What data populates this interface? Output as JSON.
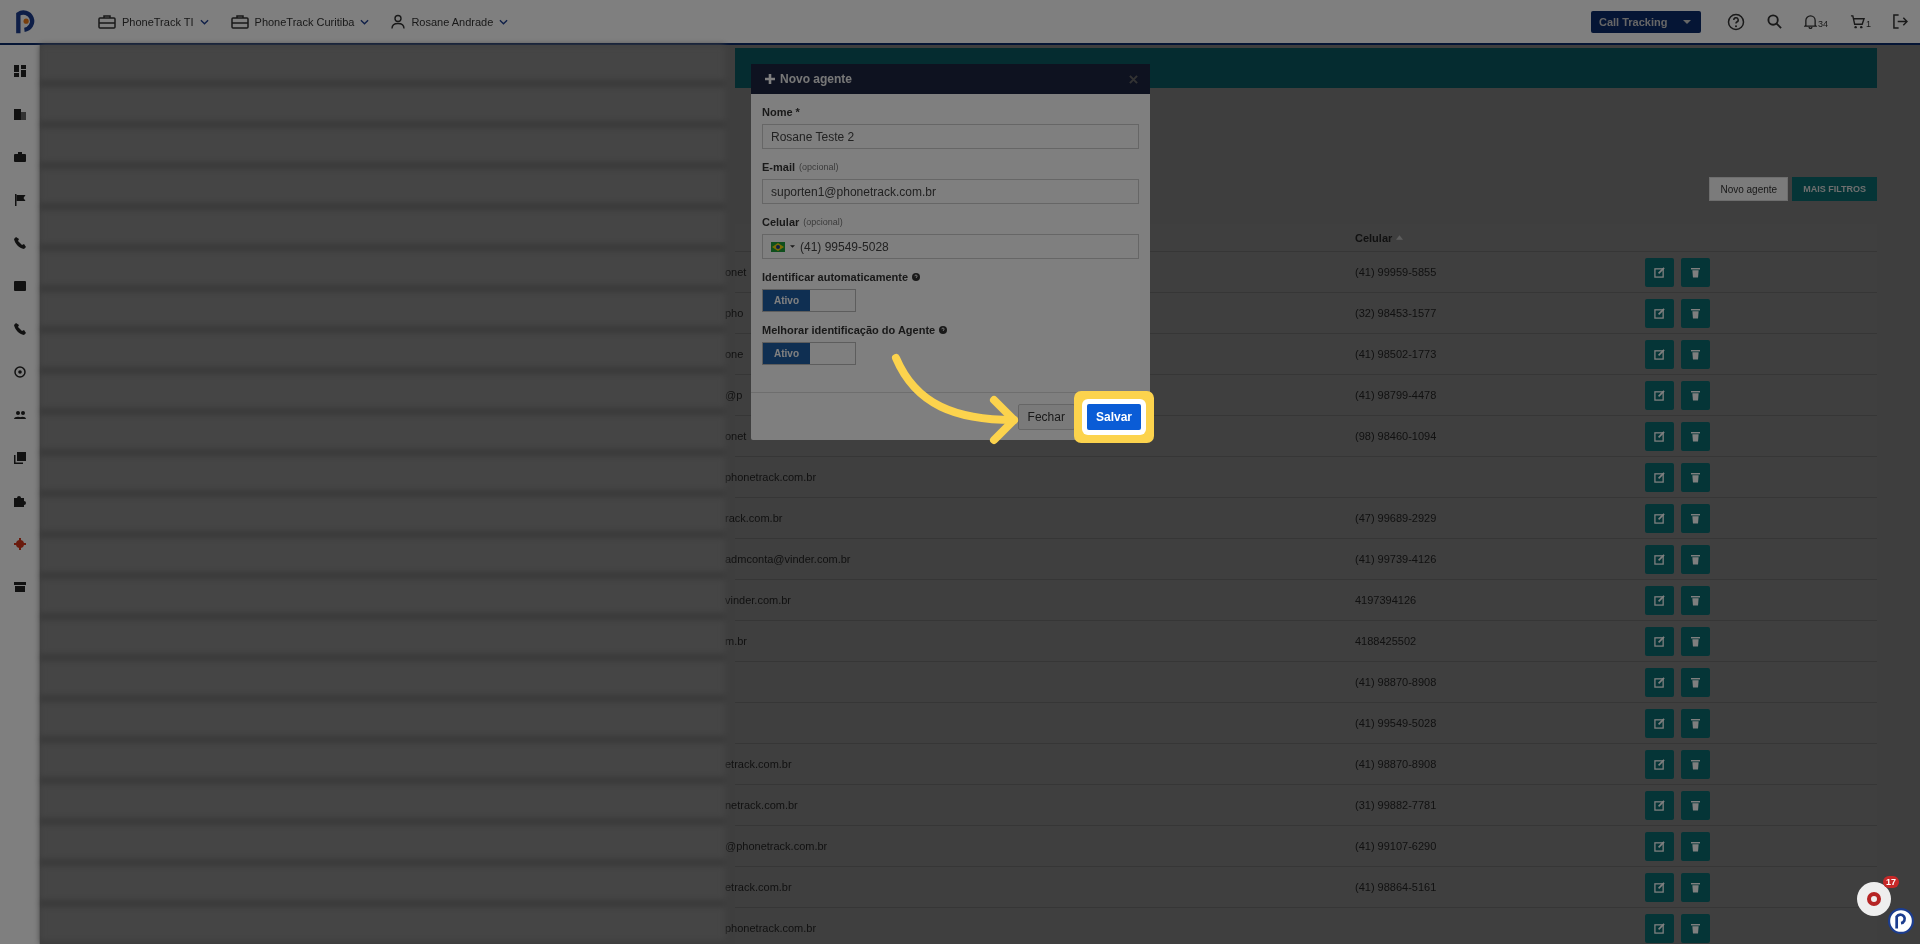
{
  "topbar": {
    "workspaces": [
      {
        "kind": "briefcase",
        "label": "PhoneTrack TI"
      },
      {
        "kind": "briefcase",
        "label": "PhoneTrack Curitiba"
      },
      {
        "kind": "user",
        "label": "Rosane Andrade"
      }
    ],
    "product_select": "Call Tracking",
    "notifications": "34",
    "cart": "1"
  },
  "sidebar": {
    "items": [
      {
        "kind": "dashboard",
        "selected": false
      },
      {
        "kind": "building",
        "selected": false
      },
      {
        "kind": "briefcase",
        "selected": false
      },
      {
        "kind": "flag",
        "selected": false
      },
      {
        "kind": "phone",
        "selected": false
      },
      {
        "kind": "card",
        "selected": false
      },
      {
        "kind": "phone",
        "selected": false
      },
      {
        "kind": "target",
        "selected": false
      },
      {
        "kind": "people",
        "selected": false
      },
      {
        "kind": "library",
        "selected": false
      },
      {
        "kind": "puzzle",
        "selected": false
      },
      {
        "kind": "gear",
        "selected": true
      },
      {
        "kind": "store",
        "selected": false
      }
    ]
  },
  "toolbar": {
    "buttons": [
      "Novo agente",
      "MAIS FILTROS"
    ]
  },
  "table": {
    "columns": [
      "Celular"
    ],
    "rows": [
      {
        "email": "onet",
        "phone": "(41) 99959-5855"
      },
      {
        "email": "pho",
        "phone": "(32) 98453-1577"
      },
      {
        "email": "one",
        "phone": "(41) 98502-1773"
      },
      {
        "email": "@p",
        "phone": "(41) 98799-4478"
      },
      {
        "email": "onet",
        "phone": "(98) 98460-1094"
      },
      {
        "email": "phonetrack.com.br",
        "phone": ""
      },
      {
        "email": "rack.com.br",
        "phone": "(47) 99689-2929"
      },
      {
        "email": "admconta@vinder.com.br",
        "phone": "(41) 99739-4126"
      },
      {
        "email": "vinder.com.br",
        "phone": "4197394126"
      },
      {
        "email": "m.br",
        "phone": "4188425502"
      },
      {
        "email": "",
        "phone": "(41) 98870-8908"
      },
      {
        "email": "",
        "phone": "(41) 99549-5028"
      },
      {
        "email": "etrack.com.br",
        "phone": "(41) 98870-8908"
      },
      {
        "email": "netrack.com.br",
        "phone": "(31) 99882-7781"
      },
      {
        "email": "@phonetrack.com.br",
        "phone": "(41) 99107-6290"
      },
      {
        "email": "etrack.com.br",
        "phone": "(41) 98864-5161"
      },
      {
        "email": "phonetrack.com.br",
        "phone": ""
      }
    ]
  },
  "modal": {
    "title": "Novo agente",
    "fields": [
      {
        "label": "Nome *",
        "value": "Rosane Teste 2",
        "kind": "text"
      },
      {
        "label": "E-mail",
        "hint": "(opcional)",
        "value": "suporten1@phonetrack.com.br",
        "kind": "text"
      },
      {
        "label": "Celular",
        "hint": "(opcional)",
        "value": "(41) 99549-5028",
        "kind": "phone"
      }
    ],
    "toggles": [
      {
        "label": "Identificar automaticamente",
        "state_label": "Ativo",
        "on": true
      },
      {
        "label": "Melhorar identificação do Agente",
        "state_label": "Ativo",
        "on": true
      }
    ],
    "buttons": [
      {
        "label": "Fechar",
        "kind": "secondary",
        "highlighted": false
      },
      {
        "label": "Salvar",
        "kind": "primary",
        "highlighted": true
      }
    ]
  },
  "chat_widget": {
    "badge": "17"
  }
}
